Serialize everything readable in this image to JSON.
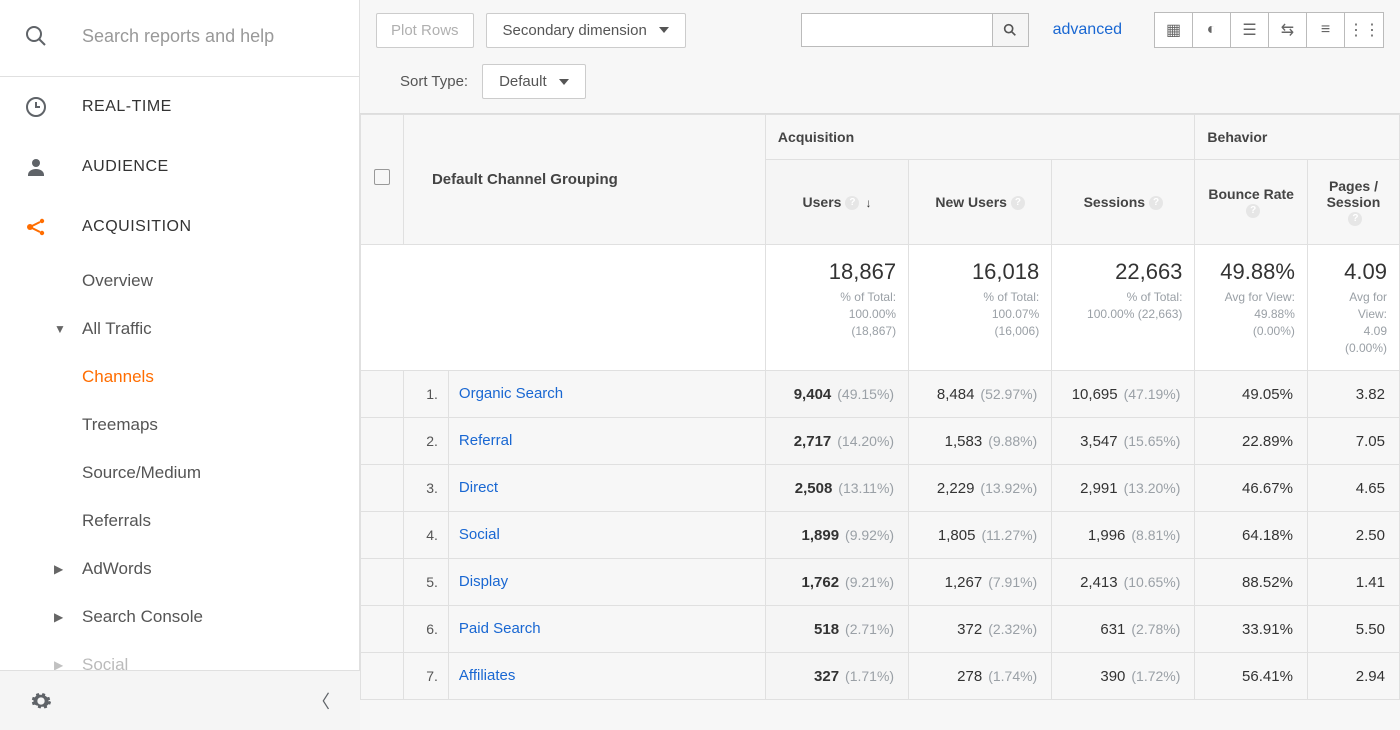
{
  "search_placeholder": "Search reports and help",
  "nav": {
    "realtime": "REAL-TIME",
    "audience": "AUDIENCE",
    "acquisition": "ACQUISITION",
    "overview": "Overview",
    "all_traffic": "All Traffic",
    "channels": "Channels",
    "treemaps": "Treemaps",
    "source_medium": "Source/Medium",
    "referrals": "Referrals",
    "adwords": "AdWords",
    "search_console": "Search Console",
    "social": "Social"
  },
  "toolbar": {
    "plot_rows": "Plot Rows",
    "secondary_dim": "Secondary dimension",
    "advanced": "advanced",
    "sort_type": "Sort Type:",
    "sort_default": "Default"
  },
  "headers": {
    "channel": "Default Channel Grouping",
    "acquisition": "Acquisition",
    "behavior": "Behavior",
    "users": "Users",
    "new_users": "New Users",
    "sessions": "Sessions",
    "bounce_rate": "Bounce Rate",
    "pages_session": "Pages / Session"
  },
  "totals": {
    "users": {
      "big": "18,867",
      "l1": "% of Total:",
      "l2": "100.00%",
      "l3": "(18,867)"
    },
    "new_users": {
      "big": "16,018",
      "l1": "% of Total:",
      "l2": "100.07%",
      "l3": "(16,006)"
    },
    "sessions": {
      "big": "22,663",
      "l1": "% of Total:",
      "l2": "100.00% (22,663)"
    },
    "bounce_rate": {
      "big": "49.88%",
      "l1": "Avg for View:",
      "l2": "49.88%",
      "l3": "(0.00%)"
    },
    "pages_session": {
      "big": "4.09",
      "l1": "Avg for",
      "l2": "View:",
      "l3": "4.09",
      "l4": "(0.00%)"
    }
  },
  "rows": [
    {
      "idx": "1.",
      "name": "Organic Search",
      "users": "9,404",
      "users_p": "(49.15%)",
      "new": "8,484",
      "new_p": "(52.97%)",
      "sess": "10,695",
      "sess_p": "(47.19%)",
      "br": "49.05%",
      "ps": "3.82"
    },
    {
      "idx": "2.",
      "name": "Referral",
      "users": "2,717",
      "users_p": "(14.20%)",
      "new": "1,583",
      "new_p": "(9.88%)",
      "sess": "3,547",
      "sess_p": "(15.65%)",
      "br": "22.89%",
      "ps": "7.05"
    },
    {
      "idx": "3.",
      "name": "Direct",
      "users": "2,508",
      "users_p": "(13.11%)",
      "new": "2,229",
      "new_p": "(13.92%)",
      "sess": "2,991",
      "sess_p": "(13.20%)",
      "br": "46.67%",
      "ps": "4.65"
    },
    {
      "idx": "4.",
      "name": "Social",
      "users": "1,899",
      "users_p": "(9.92%)",
      "new": "1,805",
      "new_p": "(11.27%)",
      "sess": "1,996",
      "sess_p": "(8.81%)",
      "br": "64.18%",
      "ps": "2.50"
    },
    {
      "idx": "5.",
      "name": "Display",
      "users": "1,762",
      "users_p": "(9.21%)",
      "new": "1,267",
      "new_p": "(7.91%)",
      "sess": "2,413",
      "sess_p": "(10.65%)",
      "br": "88.52%",
      "ps": "1.41"
    },
    {
      "idx": "6.",
      "name": "Paid Search",
      "users": "518",
      "users_p": "(2.71%)",
      "new": "372",
      "new_p": "(2.32%)",
      "sess": "631",
      "sess_p": "(2.78%)",
      "br": "33.91%",
      "ps": "5.50"
    },
    {
      "idx": "7.",
      "name": "Affiliates",
      "users": "327",
      "users_p": "(1.71%)",
      "new": "278",
      "new_p": "(1.74%)",
      "sess": "390",
      "sess_p": "(1.72%)",
      "br": "56.41%",
      "ps": "2.94"
    }
  ]
}
